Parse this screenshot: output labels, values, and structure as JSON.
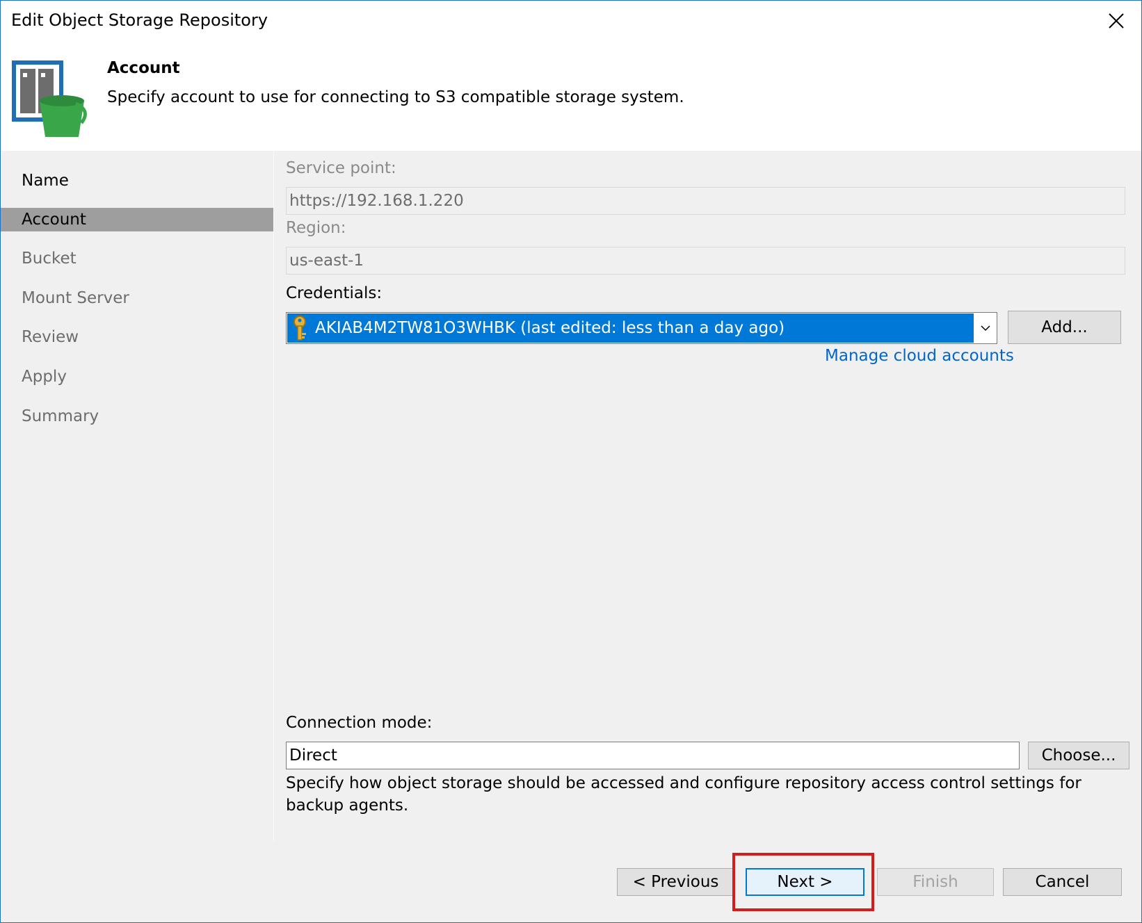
{
  "window": {
    "title": "Edit Object Storage Repository"
  },
  "header": {
    "title": "Account",
    "description": "Specify account to use for connecting to S3 compatible storage system."
  },
  "steps": [
    {
      "label": "Name",
      "state": "done"
    },
    {
      "label": "Account",
      "state": "active"
    },
    {
      "label": "Bucket",
      "state": "pending"
    },
    {
      "label": "Mount Server",
      "state": "pending"
    },
    {
      "label": "Review",
      "state": "pending"
    },
    {
      "label": "Apply",
      "state": "pending"
    },
    {
      "label": "Summary",
      "state": "pending"
    }
  ],
  "form": {
    "service_point_label": "Service point:",
    "service_point_value": "https://192.168.1.220",
    "region_label": "Region:",
    "region_value": "us-east-1",
    "credentials_label": "Credentials:",
    "credentials_value": "AKIAB4M2TW81O3WHBK (last edited: less than a day ago)",
    "add_button": "Add...",
    "manage_link": "Manage cloud accounts",
    "connection_mode_label": "Connection mode:",
    "connection_mode_value": "Direct",
    "choose_button": "Choose...",
    "connection_note": "Specify how object storage should be accessed and configure repository access control settings for backup agents."
  },
  "footer": {
    "previous": "< Previous",
    "next": "Next >",
    "finish": "Finish",
    "cancel": "Cancel"
  },
  "colors": {
    "selection": "#0078d7",
    "link": "#0066cc",
    "active_step": "#9e9e9e",
    "highlight": "#d51b1b"
  }
}
